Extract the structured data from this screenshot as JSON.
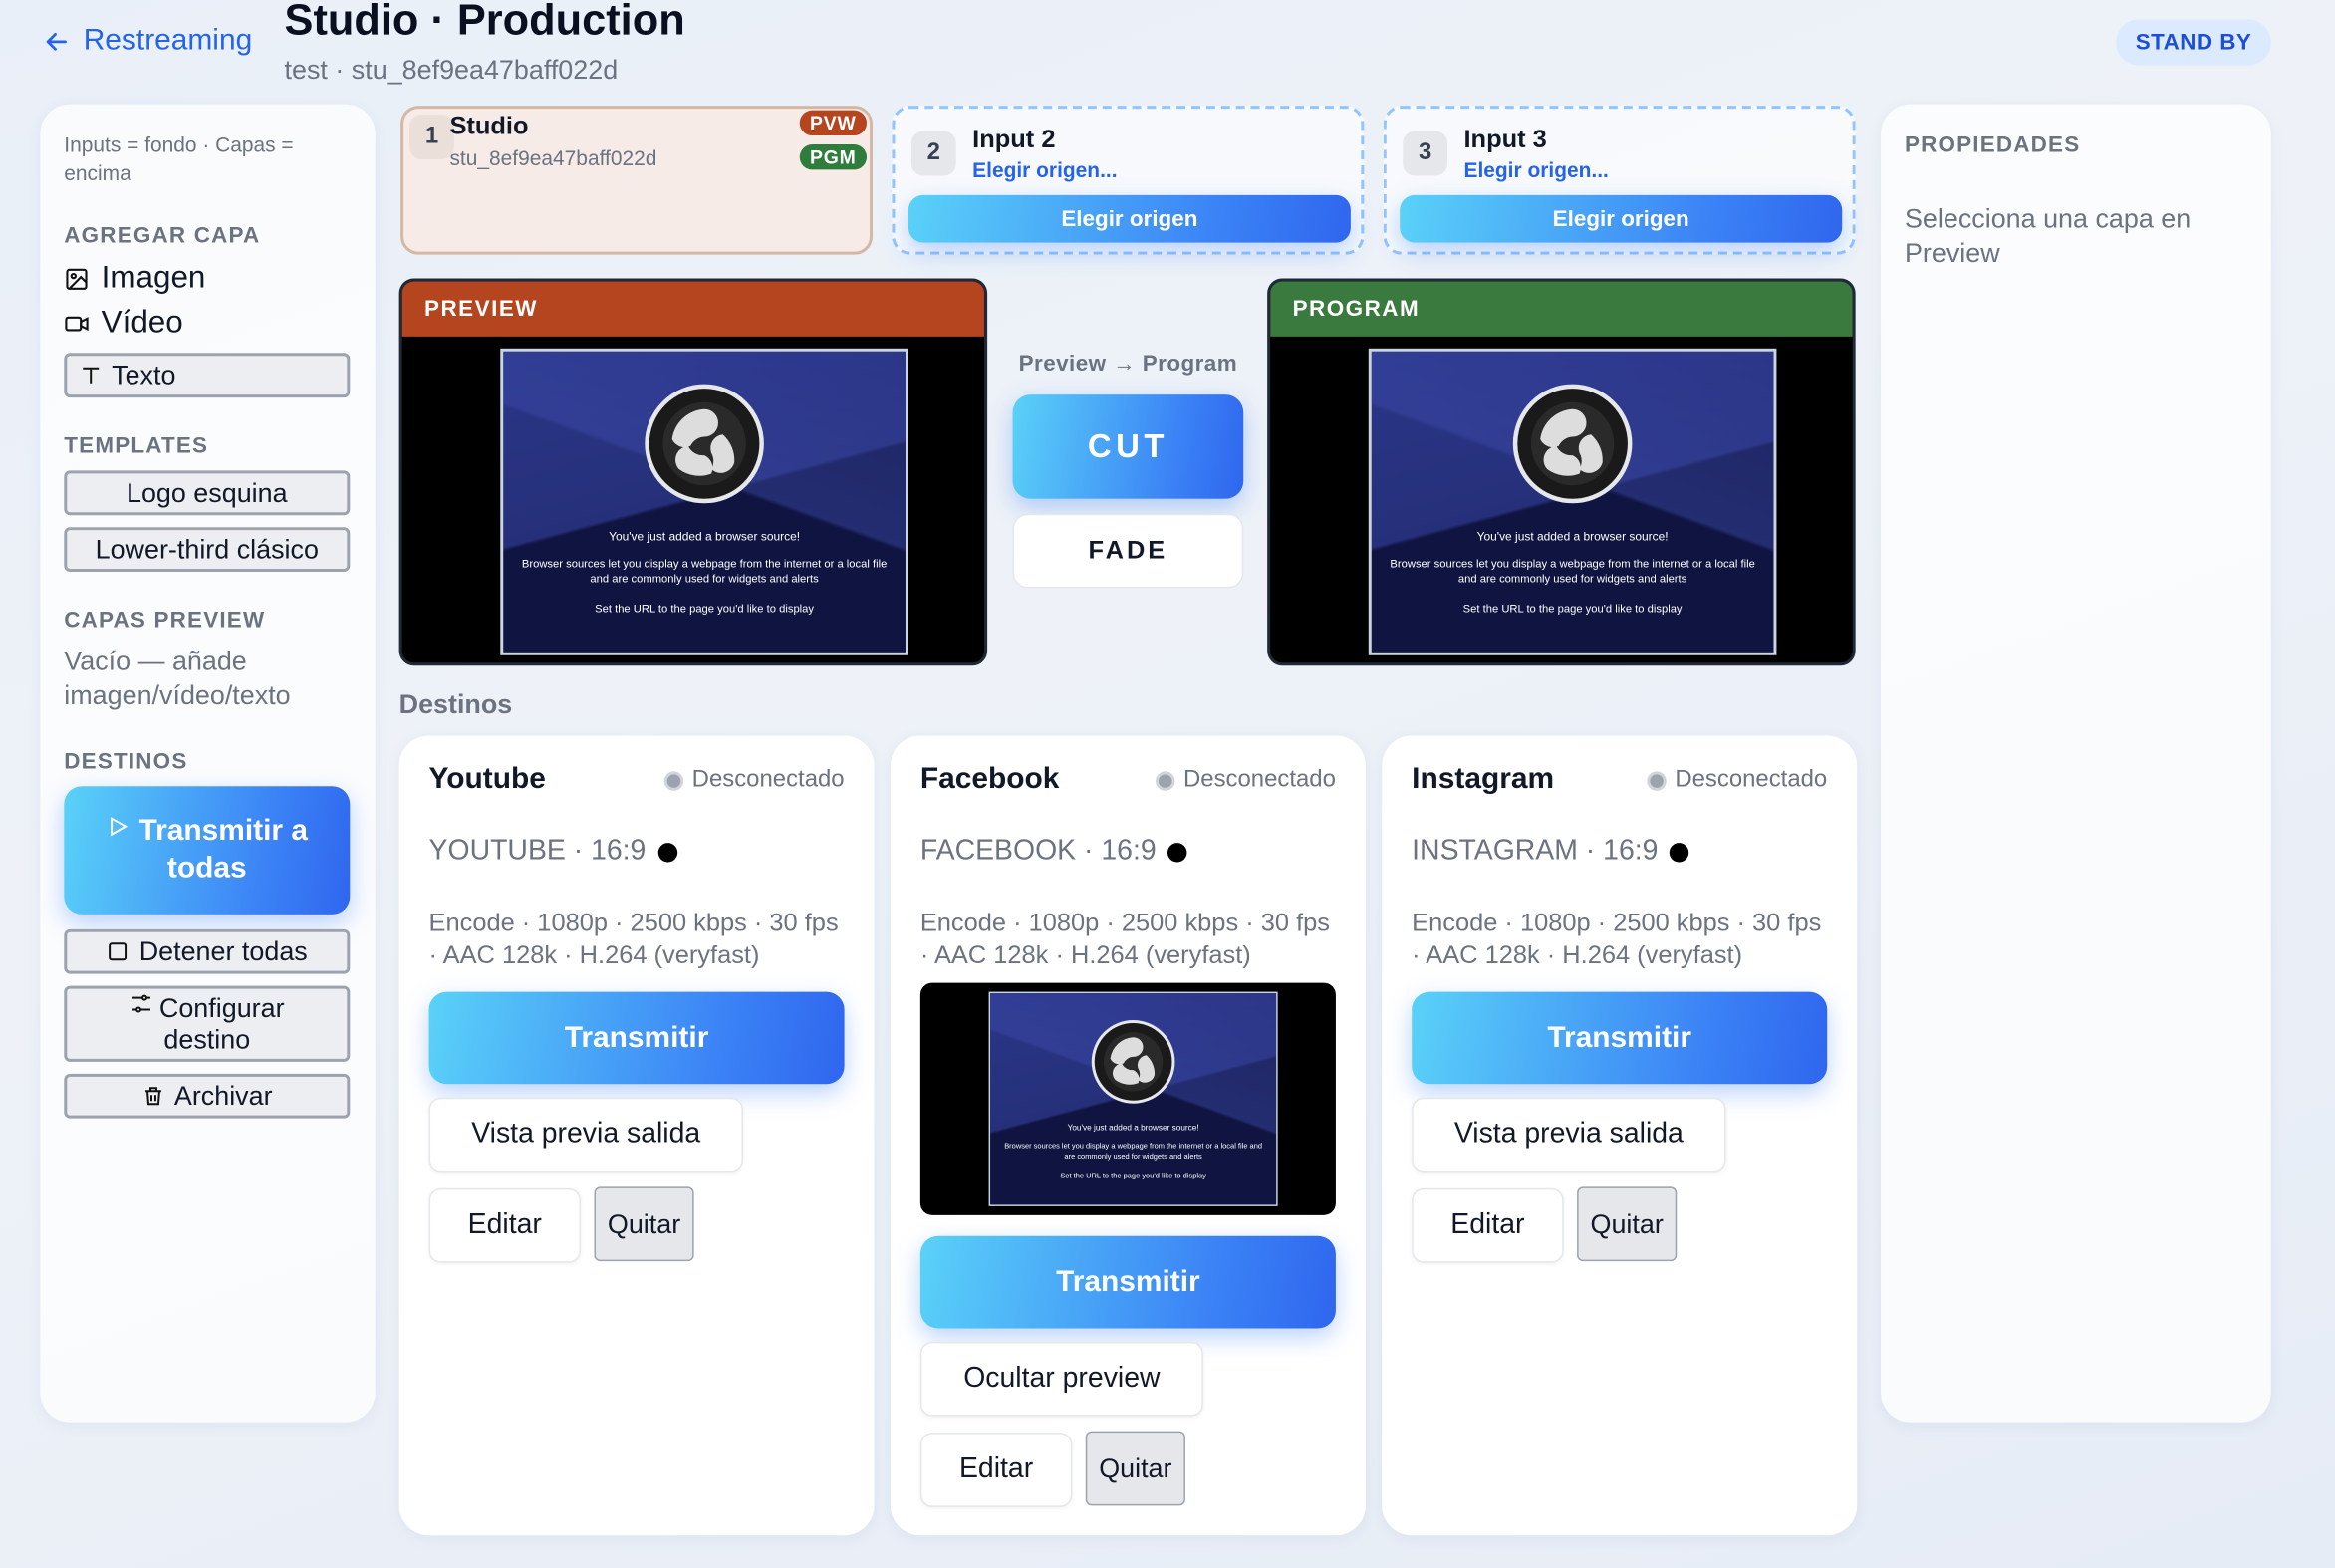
{
  "header": {
    "back_label": "Restreaming",
    "title": "Studio · Production",
    "subtitle": "test · stu_8ef9ea47baff022d",
    "status_badge": "STAND BY"
  },
  "left_panel": {
    "hint": "Inputs = fondo · Capas = encima",
    "add_layer_title": "AGREGAR CAPA",
    "image_label": "Imagen",
    "video_label": "Vídeo",
    "text_label": "Texto",
    "templates_title": "TEMPLATES",
    "template_logo": "Logo esquina",
    "template_lower_third": "Lower-third clásico",
    "layers_title": "CAPAS PREVIEW",
    "layers_empty": "Vacío — añade imagen/vídeo/texto",
    "destinations_title": "DESTINOS",
    "broadcast_all": "Transmitir a todas",
    "stop_all": "Detener todas",
    "configure_destination": "Configurar destino",
    "archive": "Archivar"
  },
  "inputs": [
    {
      "num": "1",
      "title": "Studio",
      "sub": "stu_8ef9ea47baff022d",
      "pvw": "PVW",
      "pgm": "PGM"
    },
    {
      "num": "2",
      "title": "Input 2",
      "link": "Elegir origen...",
      "button": "Elegir origen"
    },
    {
      "num": "3",
      "title": "Input 3",
      "link": "Elegir origen...",
      "button": "Elegir origen"
    }
  ],
  "preview": {
    "label": "PREVIEW",
    "line1": "You've just added a browser source!",
    "line2": "Browser sources let you display a webpage from the internet or a local file and are commonly used for widgets and alerts",
    "line3": "Set the URL to the page you'd like to display"
  },
  "program": {
    "label": "PROGRAM"
  },
  "transition": {
    "label": "Preview → Program",
    "cut": "CUT",
    "fade": "FADE"
  },
  "destinations_heading": "Destinos",
  "destinations": [
    {
      "name": "Youtube",
      "status": "Desconectado",
      "format": "YOUTUBE · 16:9",
      "encode": "Encode · 1080p · 2500 kbps · 30 fps · AAC 128k · H.264 (veryfast)",
      "transmit": "Transmitir",
      "preview_btn": "Vista previa salida",
      "edit": "Editar",
      "remove": "Quitar"
    },
    {
      "name": "Facebook",
      "status": "Desconectado",
      "format": "FACEBOOK · 16:9",
      "encode": "Encode · 1080p · 2500 kbps · 30 fps · AAC 128k · H.264 (veryfast)",
      "transmit": "Transmitir",
      "preview_btn": "Ocultar preview",
      "edit": "Editar",
      "remove": "Quitar"
    },
    {
      "name": "Instagram",
      "status": "Desconectado",
      "format": "INSTAGRAM · 16:9",
      "encode": "Encode · 1080p · 2500 kbps · 30 fps · AAC 128k · H.264 (veryfast)",
      "transmit": "Transmitir",
      "preview_btn": "Vista previa salida",
      "edit": "Editar",
      "remove": "Quitar"
    }
  ],
  "properties": {
    "title": "PROPIEDADES",
    "empty": "Selecciona una capa en Preview"
  },
  "colors": {
    "preview_header": "#b5451f",
    "program_header": "#3b7a3f",
    "accent": "#3b82f6",
    "pvw_tag": "#b5451f",
    "pgm_tag": "#2f7d3d"
  }
}
